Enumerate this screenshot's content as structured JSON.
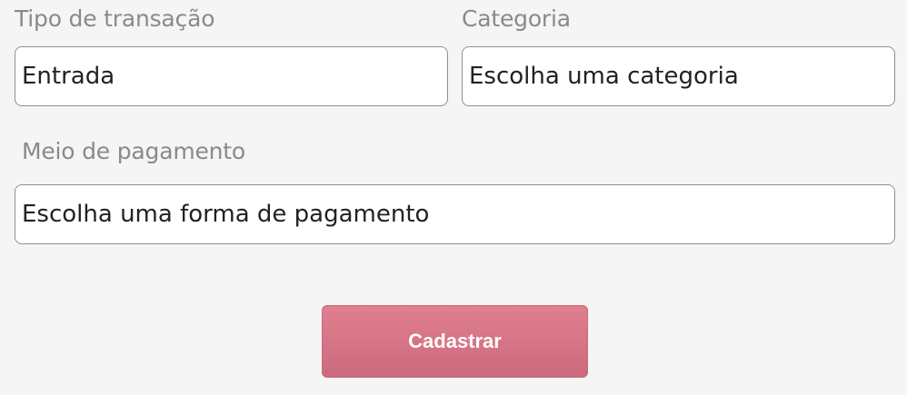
{
  "form": {
    "transaction_type": {
      "label": "Tipo de transação",
      "value": "Entrada"
    },
    "category": {
      "label": "Categoria",
      "value": "Escolha uma categoria"
    },
    "payment_method": {
      "label": "Meio de pagamento",
      "value": "Escolha uma forma de pagamento"
    },
    "submit_label": "Cadastrar"
  },
  "colors": {
    "background": "#f5f5f5",
    "label_text": "#8a8a8a",
    "field_border": "#8f8f8f",
    "button_accent": "#d97486",
    "button_text": "#ffffff"
  }
}
